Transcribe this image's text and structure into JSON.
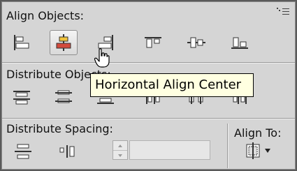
{
  "panel": {
    "align_objects_title": "Align Objects:",
    "distribute_objects_title": "Distribute Objects:",
    "distribute_spacing_title": "Distribute Spacing:",
    "align_to_title": "Align To:"
  },
  "tooltip": {
    "text": "Horizontal Align Center"
  },
  "spacing": {
    "value": ""
  },
  "colors": {
    "panel_bg": "#d5d5d5",
    "tooltip_bg": "#ffffe1",
    "highlight_red": "#d34a3c",
    "highlight_yellow": "#f0c33c"
  },
  "icons": {
    "align_row": [
      "horizontal-align-left-icon",
      "horizontal-align-center-icon",
      "horizontal-align-right-icon",
      "vertical-align-top-icon",
      "vertical-align-center-icon",
      "vertical-align-bottom-icon"
    ],
    "distribute_row": [
      "vertical-distribute-top-icon",
      "vertical-distribute-center-icon",
      "vertical-distribute-bottom-icon",
      "horizontal-distribute-left-icon",
      "horizontal-distribute-center-icon",
      "horizontal-distribute-right-icon"
    ],
    "spacing_row": [
      "vertical-distribute-space-icon",
      "horizontal-distribute-space-icon"
    ],
    "align_to": "align-to-selection-icon"
  }
}
